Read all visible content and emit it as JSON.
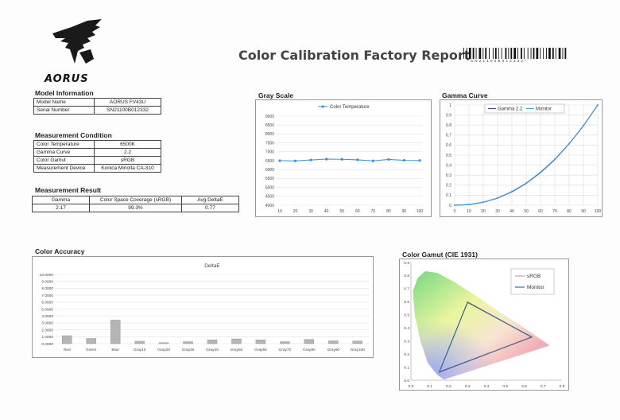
{
  "brand": {
    "logo_text": "AORUS"
  },
  "report": {
    "title": "Color Calibration Factory Report",
    "barcode_text": "* S N 2 1 1 0 0 B 0 1 2 3 3 2 *"
  },
  "model_info": {
    "title": "Model Information",
    "rows": [
      {
        "key": "Model Name",
        "value": "AORUS FV43U"
      },
      {
        "key": "Serial Number",
        "value": "SN21100B012332"
      }
    ]
  },
  "measurement_condition": {
    "title": "Measurement Condition",
    "rows": [
      {
        "key": "Color Temperature",
        "value": "6500K"
      },
      {
        "key": "Gamma Curve",
        "value": "2.2"
      },
      {
        "key": "Color Gamut",
        "value": "sRGB"
      },
      {
        "key": "Measurement Device",
        "value": "Konica Minolta  CA-310"
      }
    ]
  },
  "measurement_result": {
    "title": "Measurement Result",
    "headers": [
      "Gamma",
      "Color Space Coverage (sRGB)",
      "Avg DeltaE"
    ],
    "values": [
      "2.17",
      "99.3%",
      "0.77"
    ]
  },
  "chart_data": [
    {
      "type": "line",
      "title": "Gray Scale",
      "x": [
        10,
        20,
        30,
        40,
        50,
        60,
        70,
        80,
        90,
        100
      ],
      "series": [
        {
          "name": "Color Temperature",
          "values": [
            6500,
            6490,
            6540,
            6590,
            6580,
            6550,
            6490,
            6570,
            6520,
            6510
          ]
        }
      ],
      "xticks": [
        "10",
        "20",
        "30",
        "40",
        "50",
        "60",
        "70",
        "80",
        "90",
        "100"
      ],
      "yticks": [
        "4000",
        "4500",
        "5000",
        "5500",
        "6000",
        "6500",
        "7000",
        "7500",
        "8000",
        "8500",
        "9000"
      ],
      "ylim": [
        4000,
        9000
      ],
      "grid": true,
      "legend": "top",
      "colors": {
        "series": "#3a8fd8"
      }
    },
    {
      "type": "line",
      "title": "Gamma Curve",
      "x": [
        0,
        10,
        20,
        30,
        40,
        50,
        60,
        70,
        80,
        90,
        100
      ],
      "series": [
        {
          "name": "Gamma 2.2",
          "values": [
            0,
            0.006,
            0.029,
            0.071,
            0.133,
            0.218,
            0.325,
            0.456,
            0.612,
            0.793,
            1.0
          ]
        },
        {
          "name": "Monitor",
          "values": [
            0,
            0.007,
            0.031,
            0.073,
            0.137,
            0.222,
            0.33,
            0.46,
            0.615,
            0.795,
            1.0
          ]
        }
      ],
      "xticks": [
        "0",
        "10",
        "20",
        "30",
        "40",
        "50",
        "60",
        "70",
        "80",
        "90",
        "100"
      ],
      "yticks": [
        "0",
        "0.1",
        "0.2",
        "0.3",
        "0.4",
        "0.5",
        "0.6",
        "0.7",
        "0.8",
        "0.9",
        "1"
      ],
      "xlim": [
        0,
        100
      ],
      "ylim": [
        0,
        1
      ],
      "grid": true,
      "legend": "top",
      "colors": {
        "gamma": "#3d4e8a",
        "monitor": "#4aa3df"
      }
    },
    {
      "type": "bar",
      "title": "Color Accuracy",
      "subtitle": "DeltaE",
      "categories": [
        "Red",
        "Green",
        "Blue",
        "Gray10",
        "Gray20",
        "Gray30",
        "Gray40",
        "Gray50",
        "Gray60",
        "Gray70",
        "Gray80",
        "Gray90",
        "Gray100"
      ],
      "values": [
        1.15,
        0.75,
        3.4,
        0.35,
        0.15,
        0.28,
        0.55,
        0.68,
        0.55,
        0.28,
        0.6,
        0.4,
        0.38
      ],
      "yticks": [
        "0.0000",
        "1.0000",
        "2.0000",
        "3.0000",
        "4.0000",
        "5.0000",
        "6.0000",
        "7.0000",
        "8.0000",
        "9.0000",
        "10.0000"
      ],
      "ylim": [
        0,
        10
      ],
      "grid": true,
      "colors": {
        "bar": "#b5b5b5"
      }
    },
    {
      "type": "scatter",
      "title": "Color Gamut (CIE 1931)",
      "series": [
        {
          "name": "sRGB",
          "points": [
            [
              0.64,
              0.33
            ],
            [
              0.3,
              0.6
            ],
            [
              0.15,
              0.06
            ]
          ]
        },
        {
          "name": "Monitor",
          "points": [
            [
              0.64,
              0.33
            ],
            [
              0.3,
              0.595
            ],
            [
              0.15,
              0.063
            ]
          ]
        }
      ],
      "xticks": [
        "0.0",
        "0.1",
        "0.2",
        "0.3",
        "0.4",
        "0.5",
        "0.6",
        "0.7",
        "0.8"
      ],
      "yticks": [
        "0.0",
        "0.1",
        "0.2",
        "0.3",
        "0.4",
        "0.5",
        "0.6",
        "0.7",
        "0.8",
        "0.9"
      ],
      "xlim": [
        0,
        0.8
      ],
      "ylim": [
        0,
        0.9
      ],
      "legend": "top-right",
      "colors": {
        "srgb": "#e07080",
        "monitor": "#2a5f8a"
      }
    }
  ]
}
